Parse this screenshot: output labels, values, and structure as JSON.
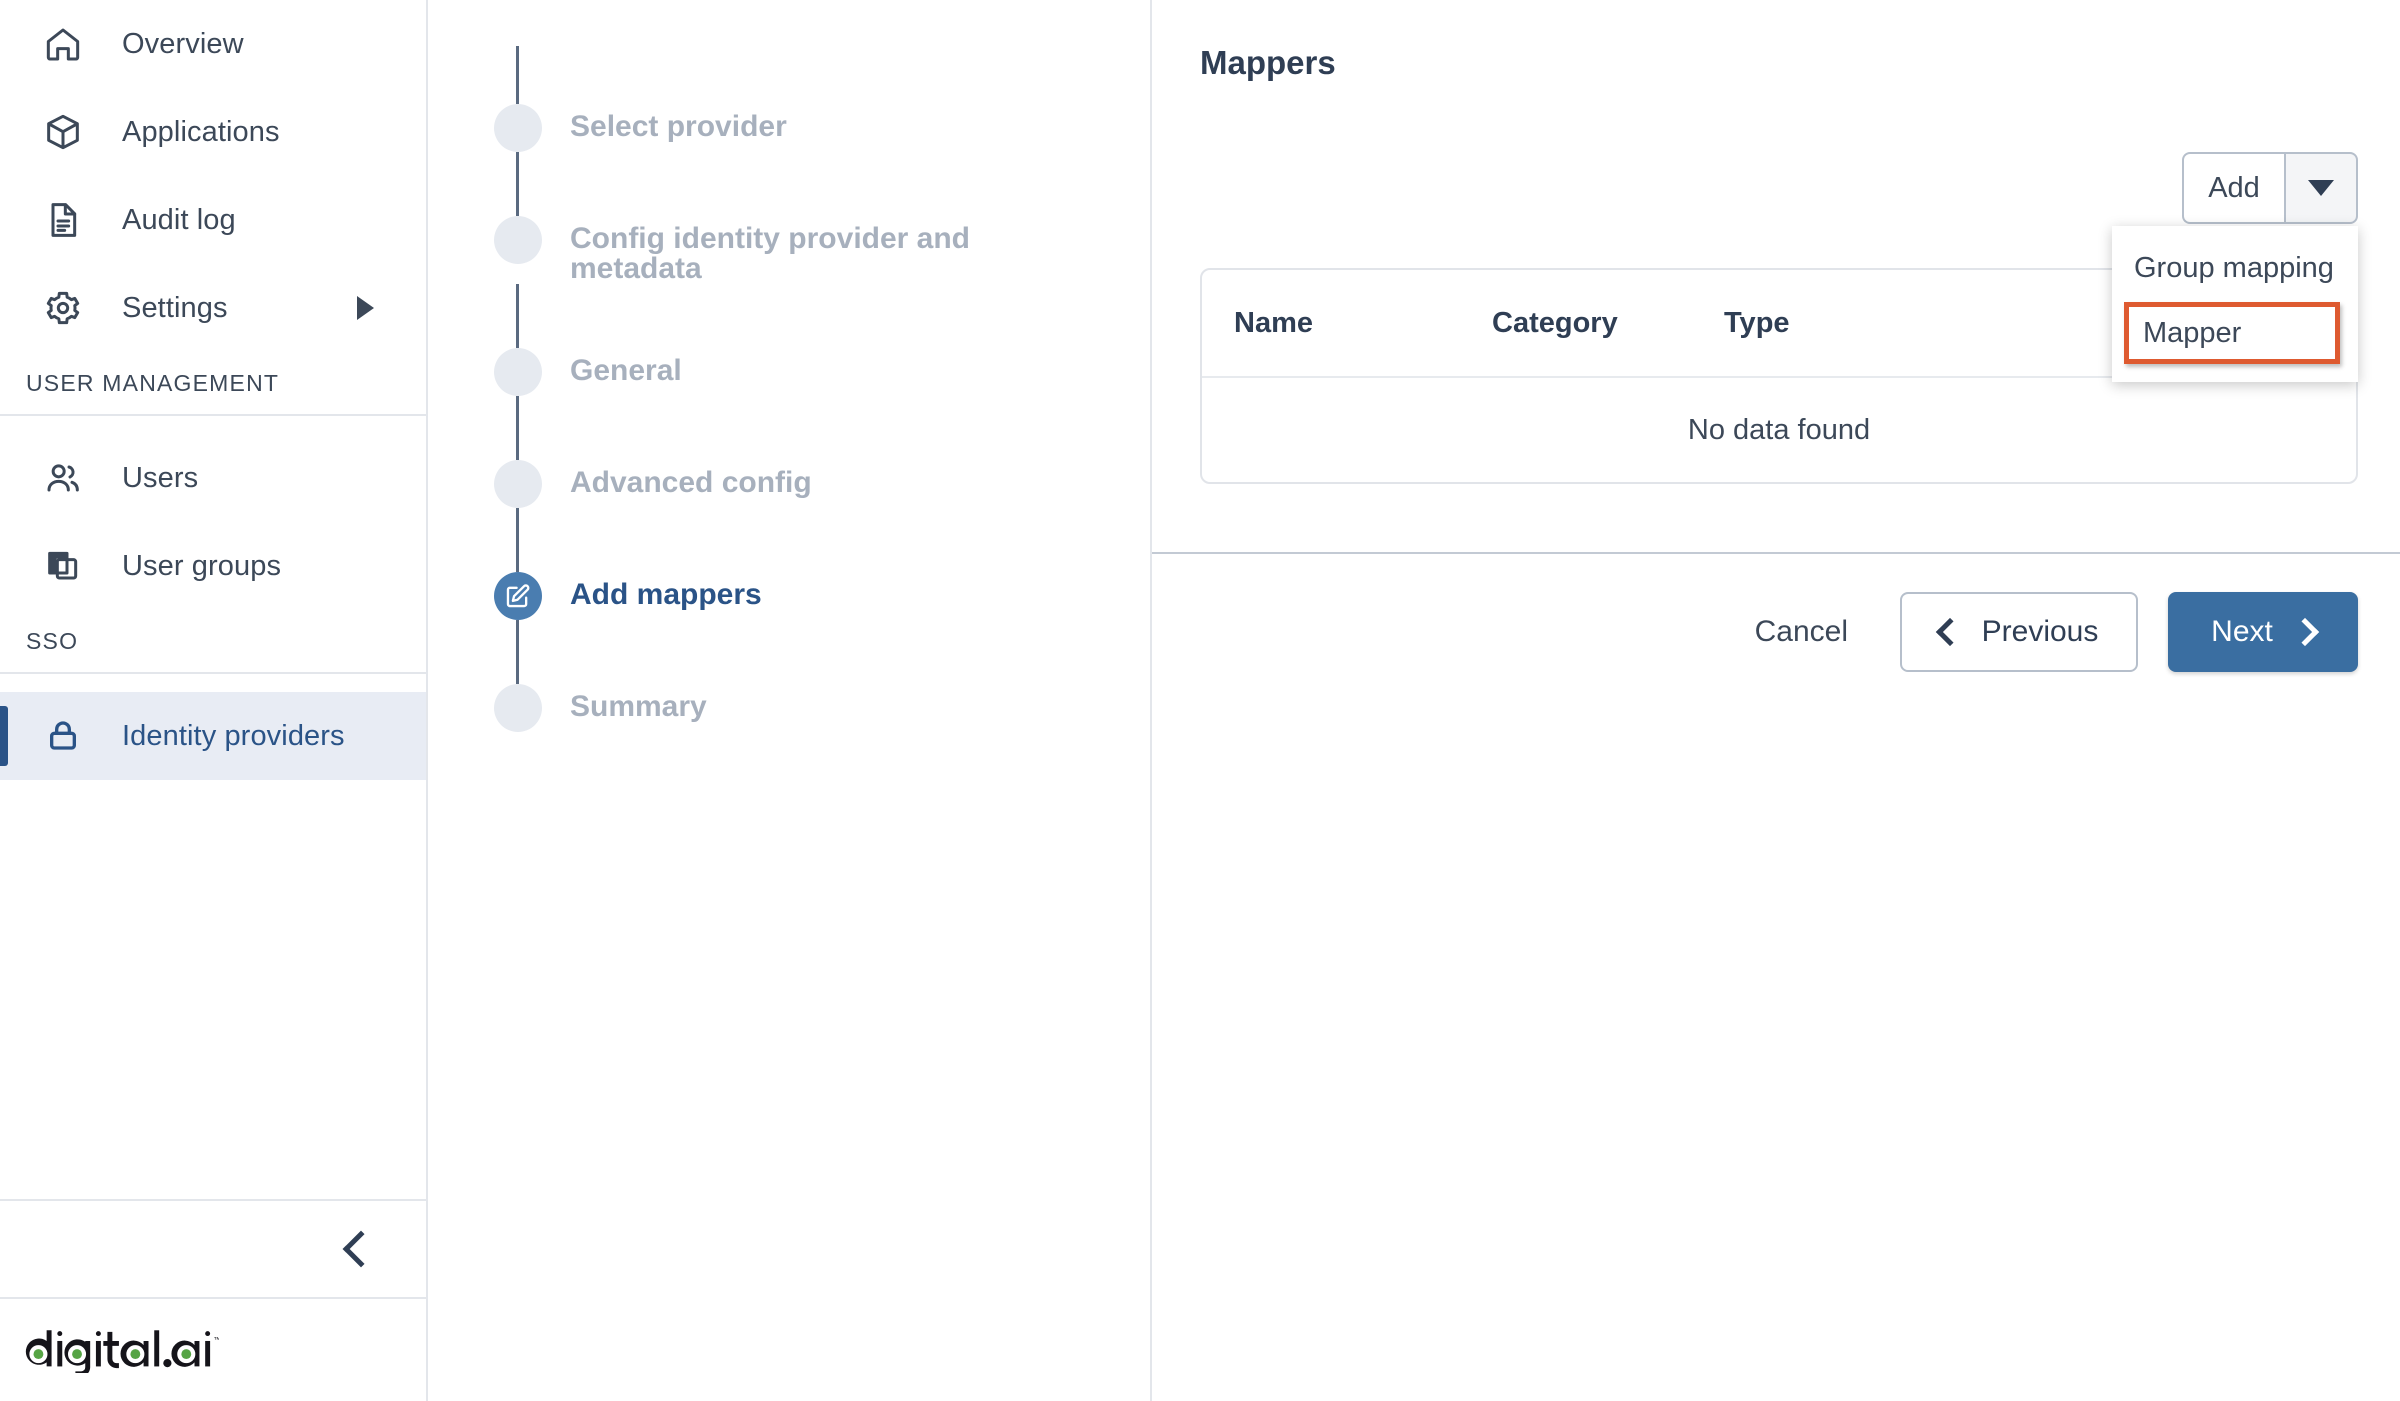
{
  "sidebar": {
    "primary_items": [
      {
        "label": "Overview",
        "icon": "home-icon",
        "has_arrow": false,
        "active": false
      },
      {
        "label": "Applications",
        "icon": "package-icon",
        "has_arrow": false,
        "active": false
      },
      {
        "label": "Audit log",
        "icon": "document-icon",
        "has_arrow": false,
        "active": false
      },
      {
        "label": "Settings",
        "icon": "gear-icon",
        "has_arrow": true,
        "active": false
      }
    ],
    "user_management_label": "USER MANAGEMENT",
    "user_management_items": [
      {
        "label": "Users",
        "icon": "users-icon",
        "active": false
      },
      {
        "label": "User groups",
        "icon": "layers-icon",
        "active": false
      }
    ],
    "sso_label": "SSO",
    "sso_items": [
      {
        "label": "Identity providers",
        "icon": "lock-icon",
        "active": true
      }
    ],
    "collapse_icon": "chevron-left-icon",
    "brand": "digital.ai",
    "accent_color": "#2a5387",
    "active_bg_color": "#e8ecf4"
  },
  "stepper": {
    "steps": [
      {
        "label": "Select provider",
        "state": "pending"
      },
      {
        "label": "Config identity provider and metadata",
        "state": "pending"
      },
      {
        "label": "General",
        "state": "pending"
      },
      {
        "label": "Advanced config",
        "state": "pending"
      },
      {
        "label": "Add mappers",
        "state": "current",
        "icon": "edit-square-icon"
      },
      {
        "label": "Summary",
        "state": "pending"
      }
    ],
    "current_color": "#2a5387",
    "pending_color": "#a7b0bd"
  },
  "main": {
    "title": "Mappers",
    "add_button": {
      "label": "Add",
      "caret_icon": "caret-down-icon"
    },
    "dropdown": {
      "open": true,
      "items": [
        {
          "label": "Group mapping",
          "highlighted": false
        },
        {
          "label": "Mapper",
          "highlighted": true
        }
      ],
      "highlight_color": "#de5a30"
    },
    "table": {
      "columns": [
        "Name",
        "Category",
        "Type"
      ],
      "rows": [],
      "empty_message": "No data found"
    },
    "footer": {
      "cancel_label": "Cancel",
      "previous_label": "Previous",
      "previous_icon": "chevron-left-icon",
      "next_label": "Next",
      "next_icon": "chevron-right-icon",
      "next_color": "#3a6ea1"
    }
  }
}
